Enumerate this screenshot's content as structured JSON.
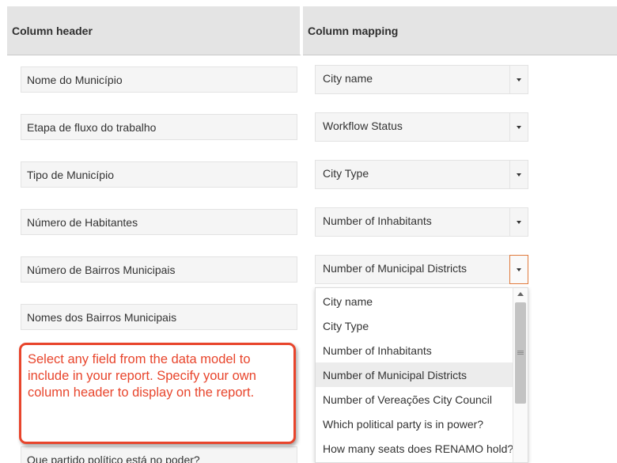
{
  "table": {
    "header_left": "Column header",
    "header_right": "Column mapping"
  },
  "rows": [
    {
      "header": "Nome do Município",
      "mapping": "City name"
    },
    {
      "header": "Etapa de fluxo do trabalho",
      "mapping": "Workflow Status"
    },
    {
      "header": "Tipo de Município",
      "mapping": "City Type"
    },
    {
      "header": "Número de Habitantes",
      "mapping": "Number of Inhabitants"
    },
    {
      "header": "Número de Bairros Municipais",
      "mapping": "Number of Municipal Districts"
    },
    {
      "header": "Nomes dos Bairros Municipais"
    },
    {
      "header": "Que partido político está no poder?"
    }
  ],
  "dropdown": {
    "options": [
      "City name",
      "City Type",
      "Number of Inhabitants",
      "Number of Municipal Districts",
      "Number of Vereações City Council",
      "Which political party is in power?",
      "How many seats does RENAMO hold?"
    ],
    "selected": "Number of Municipal Districts"
  },
  "callout": {
    "text": "Select any field from the data model to include in your report.  Specify your own column header to display on the report."
  },
  "colors": {
    "accent": "#e8452c",
    "header_bg": "#e4e4e4",
    "active_border": "#e07a3c",
    "highlight": "#ececec"
  }
}
